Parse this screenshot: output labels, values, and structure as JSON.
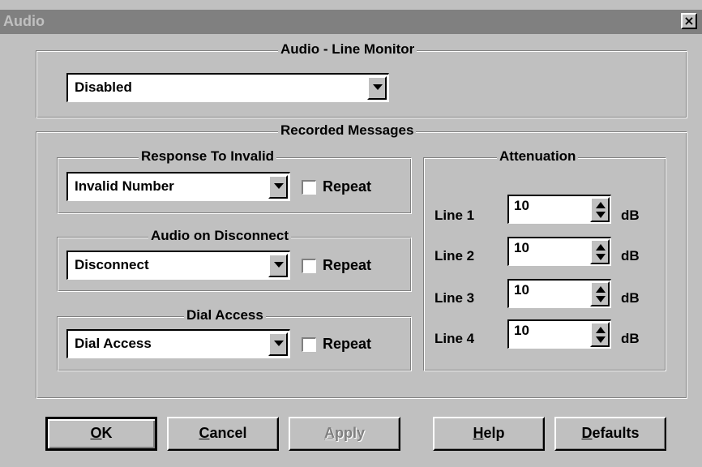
{
  "window": {
    "title": "Audio",
    "close_glyph": "×"
  },
  "line_monitor": {
    "legend": "Audio - Line Monitor",
    "selected": "Disabled"
  },
  "recorded": {
    "legend": "Recorded Messages",
    "invalid": {
      "legend": "Response To Invalid",
      "selected": "Invalid Number",
      "repeat_label": "Repeat",
      "repeat_checked": false
    },
    "disconnect": {
      "legend": "Audio on Disconnect",
      "selected": "Disconnect",
      "repeat_label": "Repeat",
      "repeat_checked": false
    },
    "dial": {
      "legend": "Dial Access",
      "selected": "Dial Access",
      "repeat_label": "Repeat",
      "repeat_checked": false
    }
  },
  "attenuation": {
    "legend": "Attenuation",
    "unit": "dB",
    "lines": [
      {
        "label": "Line 1",
        "value": "10"
      },
      {
        "label": "Line 2",
        "value": "10"
      },
      {
        "label": "Line 3",
        "value": "10"
      },
      {
        "label": "Line 4",
        "value": "10"
      }
    ]
  },
  "buttons": {
    "ok": {
      "mnemonic": "O",
      "rest": "K"
    },
    "cancel": {
      "mnemonic": "C",
      "rest": "ancel"
    },
    "apply": {
      "mnemonic": "A",
      "rest": "pply",
      "enabled": false
    },
    "help": {
      "mnemonic": "H",
      "rest": "elp"
    },
    "defaults": {
      "mnemonic": "D",
      "rest": "efaults"
    }
  }
}
